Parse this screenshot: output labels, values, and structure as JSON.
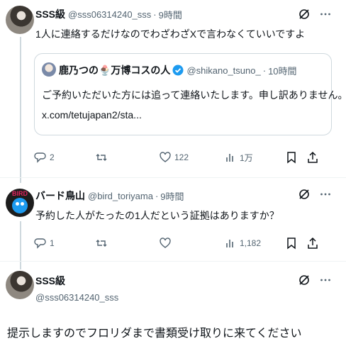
{
  "tweet1": {
    "name": "SSS級",
    "handle": "@sss06314240_sss",
    "time": "9時間",
    "dot": "·",
    "text": "1人に連絡するだけなのでわざわざXで言わなくていいですよ",
    "quote": {
      "name": "鹿乃つの🍨万博コスの人",
      "handle": "@shikano_tsuno_",
      "time": "10時間",
      "dot": "·",
      "text": "ご予約いただいた方には追って連絡いたします。申し訳ありません。",
      "link": "x.com/tetujapan2/sta..."
    },
    "replies": "2",
    "likes": "122",
    "views": "1万"
  },
  "tweet2": {
    "name": "バード鳥山",
    "handle": "@bird_toriyama",
    "time": "9時間",
    "dot": "·",
    "text": "予約した人がたったの1人だという証拠はありますか？",
    "replies": "1",
    "views": "1,182",
    "avatar_text": "BIRD"
  },
  "tweet3": {
    "name": "SSS級",
    "handle": "@sss06314240_sss",
    "text": "提示しますのでフロリダまで書類受け取りに来てください"
  },
  "icons": {
    "grok": "grok-icon",
    "more": "more-icon",
    "reply": "reply-icon",
    "repost": "repost-icon",
    "like": "heart-icon",
    "views": "views-icon",
    "bookmark": "bookmark-icon",
    "share": "share-icon",
    "verified": "verified-badge-icon"
  },
  "colors": {
    "accent": "#1d9bf0",
    "muted": "#536471",
    "border": "#cfd9de"
  }
}
